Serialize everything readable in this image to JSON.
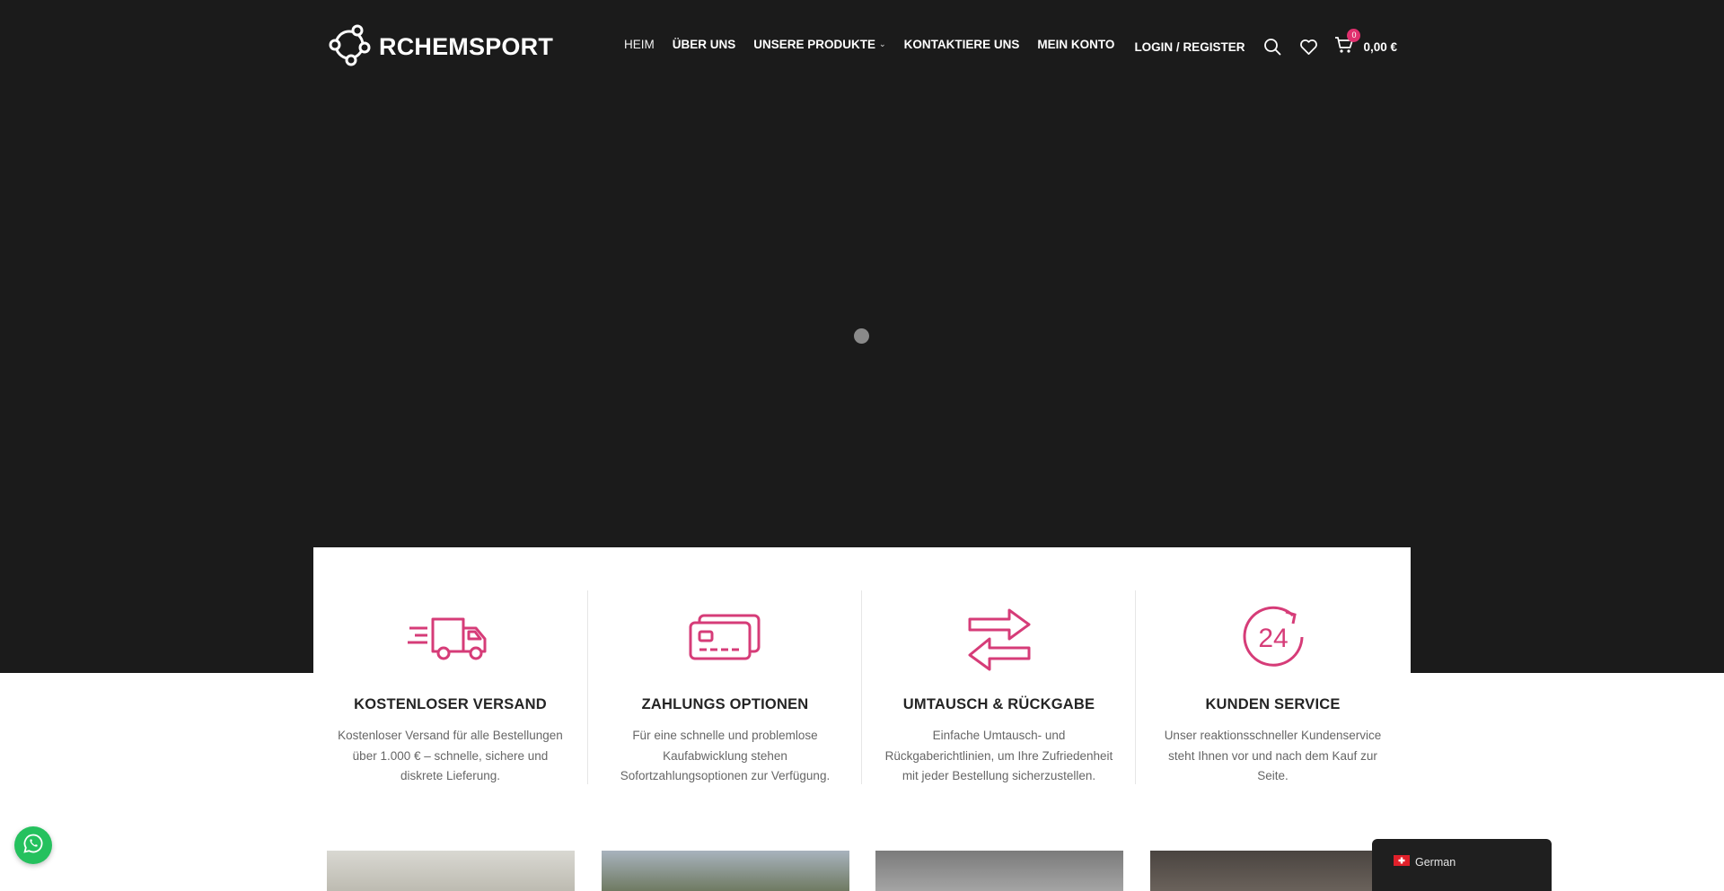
{
  "header": {
    "logo_text": "RCHEMSPORT",
    "nav": [
      {
        "label": "HEIM"
      },
      {
        "label": "ÜBER UNS"
      },
      {
        "label": "UNSERE PRODUKTE"
      },
      {
        "label": "KONTAKTIERE UNS"
      },
      {
        "label": "MEIN KONTO"
      }
    ],
    "login_label": "LOGIN / REGISTER",
    "cart_count": "0",
    "cart_total": "0,00 €",
    "icons": [
      "search-icon",
      "heart-icon",
      "cart-icon"
    ]
  },
  "features": [
    {
      "icon": "truck-icon",
      "title": "KOSTENLOSER VERSAND",
      "desc": "Kostenloser Versand für alle Bestellungen über 1.000 € – schnelle, sichere und diskrete Lieferung."
    },
    {
      "icon": "credit-cards-icon",
      "title": "ZAHLUNGS OPTIONEN",
      "desc": "Für eine schnelle und problemlose Kaufabwicklung stehen Sofortzahlungsoptionen zur Verfügung."
    },
    {
      "icon": "exchange-arrows-icon",
      "title": "UMTAUSCH & RÜCKGABE",
      "desc": "Einfache Umtausch- und Rückgaberichtlinien, um Ihre Zufriedenheit mit jeder Bestellung sicherzustellen."
    },
    {
      "icon": "clock-24-icon",
      "title": "KUNDEN SERVICE",
      "desc": "Unser reaktionsschneller Kundenservice steht Ihnen vor und nach dem Kauf zur Seite."
    }
  ],
  "language": {
    "label": "German",
    "flag_icon": "swiss-flag-icon"
  },
  "colors": {
    "accent": "#d63c78",
    "hero_bg": "#1b1b1b",
    "whatsapp": "#25c15e"
  }
}
